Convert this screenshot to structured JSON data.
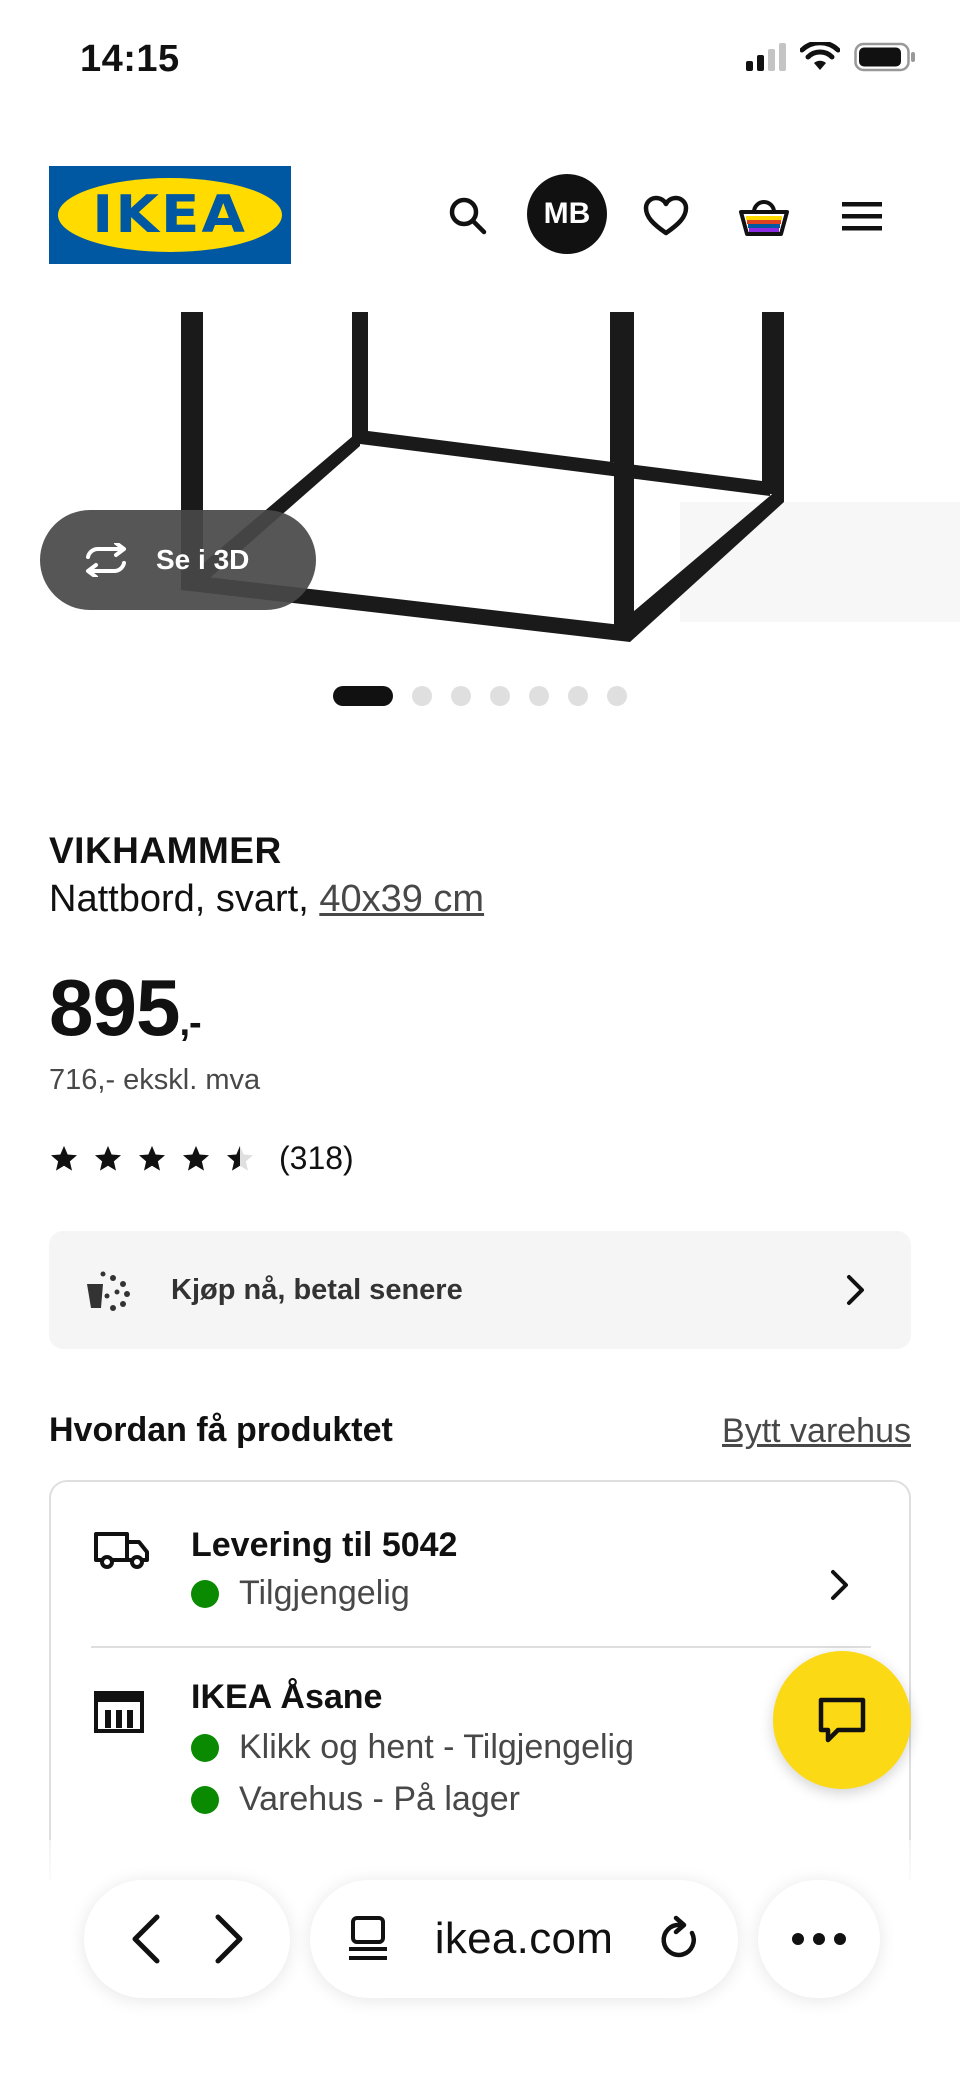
{
  "status_bar": {
    "time": "14:15"
  },
  "header": {
    "logo_text": "IKEA",
    "avatar_initials": "MB",
    "icons": [
      "search-icon",
      "heart-icon",
      "basket-icon",
      "menu-icon"
    ]
  },
  "gallery": {
    "view_3d_label": "Se i 3D",
    "image_count": 7,
    "active_index": 0
  },
  "product": {
    "name": "VIKHAMMER",
    "description": "Nattbord, svart, ",
    "size_link": "40x39 cm",
    "price": "895",
    "price_suffix": ",-",
    "price_ex_vat": "716,- ekskl. mva",
    "rating_value": 4.5,
    "rating_max": 5,
    "rating_count": "(318)"
  },
  "bnpl": {
    "label": "Kjøp nå, betal senere"
  },
  "delivery": {
    "title": "Hvordan få produktet",
    "change_store": "Bytt varehus",
    "options": [
      {
        "title": "Levering til 5042",
        "statuses": [
          "Tilgjengelig"
        ]
      },
      {
        "title": "IKEA Åsane",
        "statuses": [
          "Klikk og hent - Tilgjengelig",
          "Varehus - På lager"
        ]
      }
    ]
  },
  "browser": {
    "url": "ikea.com"
  },
  "colors": {
    "ikea_blue": "#0058a3",
    "ikea_yellow": "#ffdb00",
    "status_green": "#0a8a00",
    "chat_yellow": "#fbd914"
  }
}
